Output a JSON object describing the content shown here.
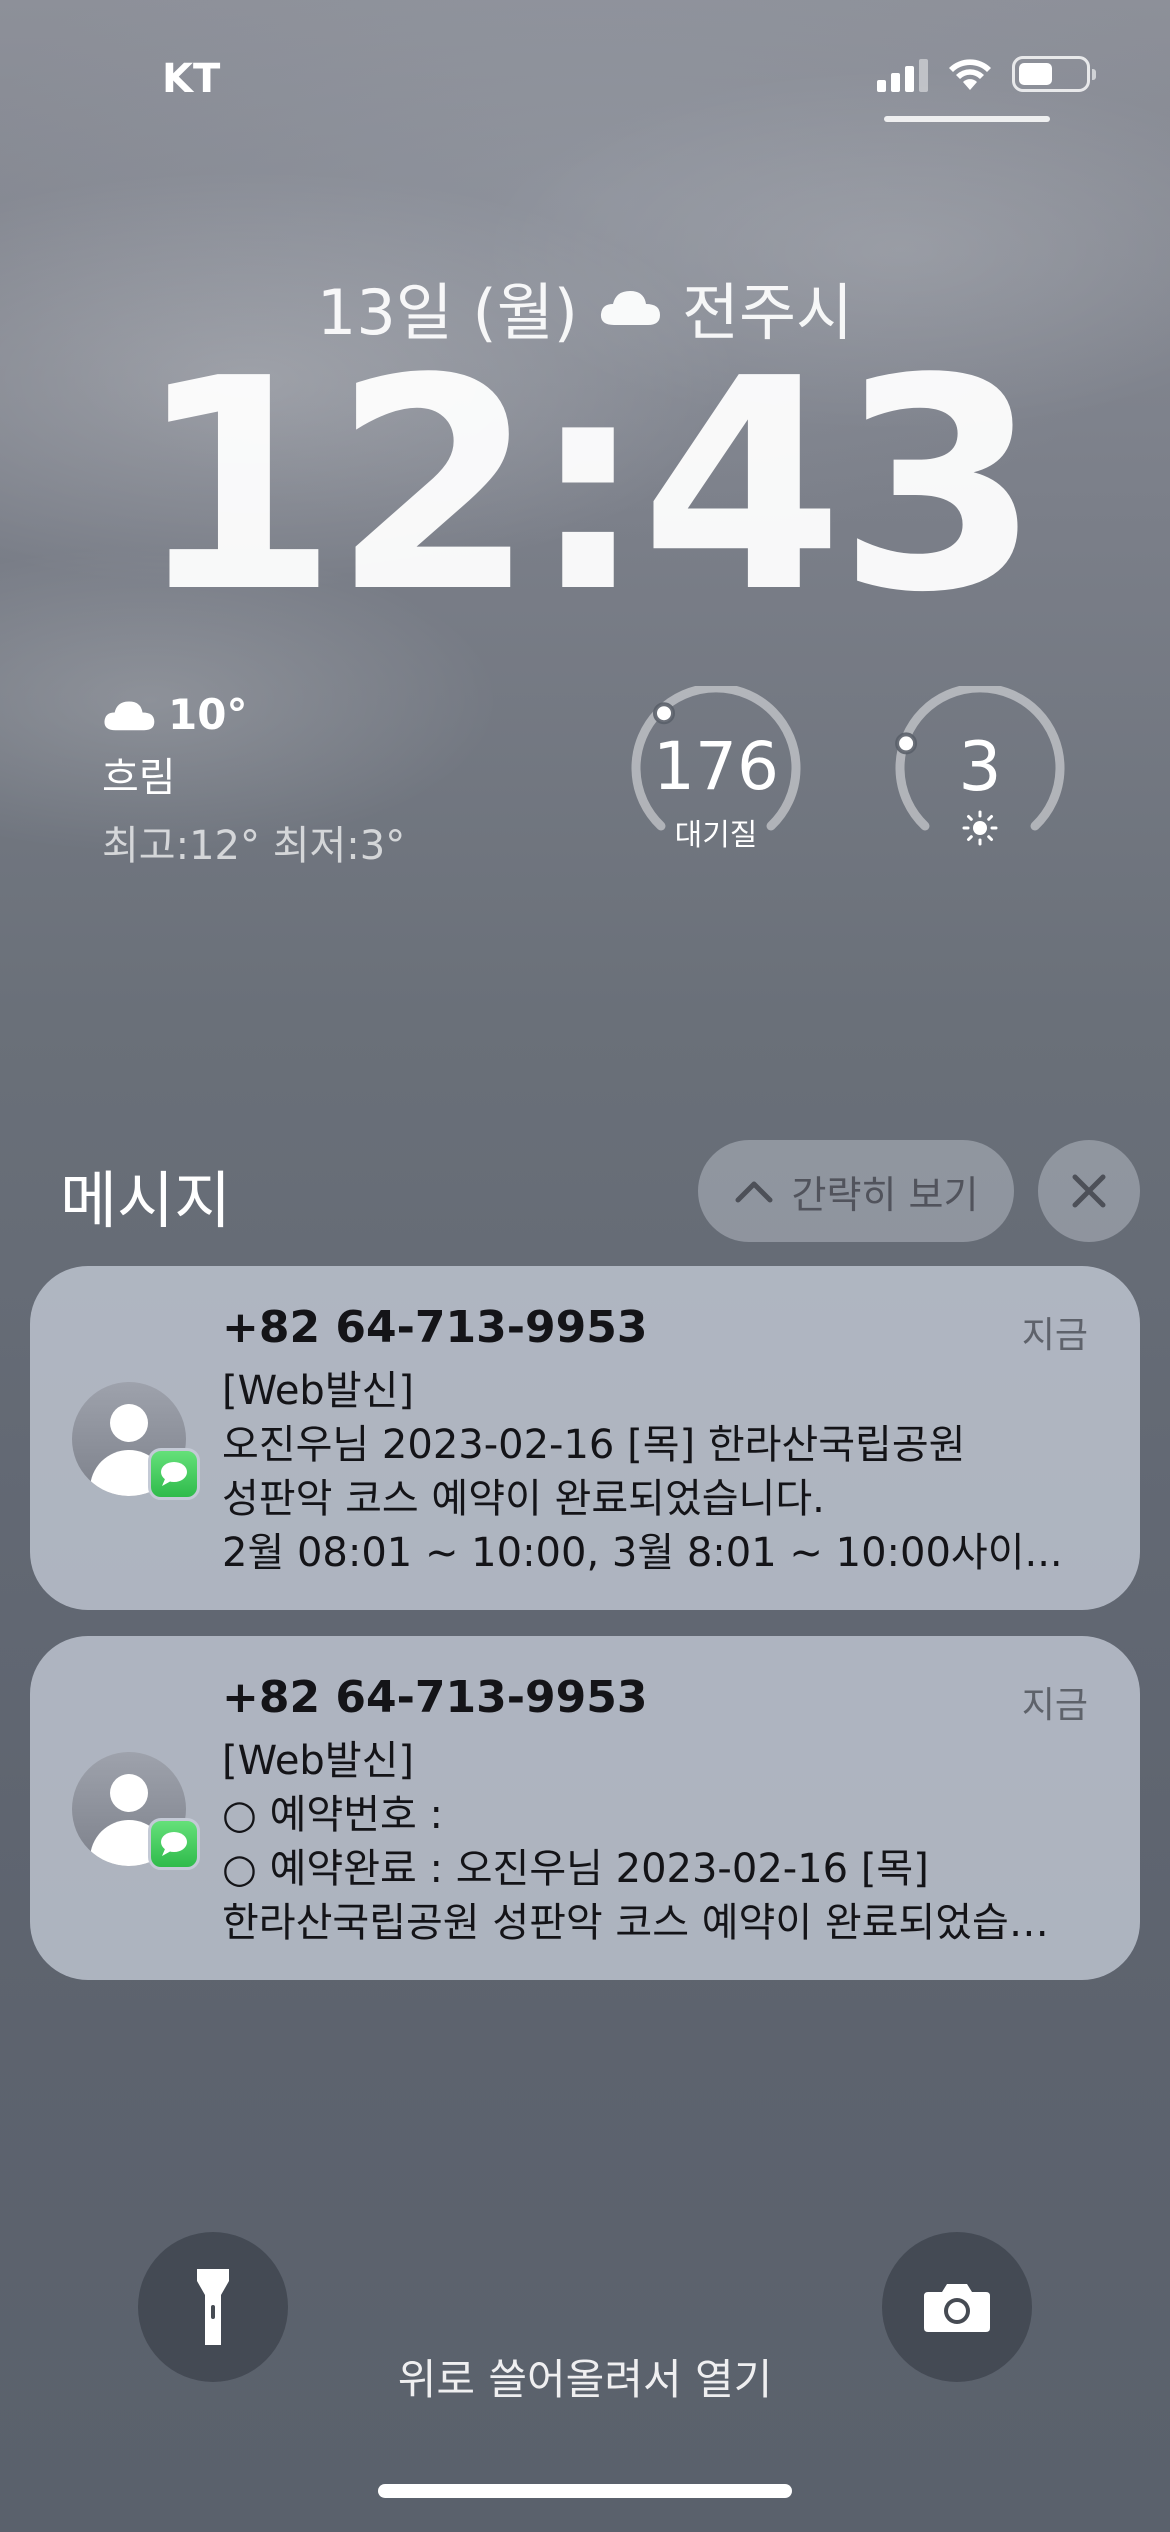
{
  "status_bar": {
    "carrier": "KT",
    "battery_level": 0.5
  },
  "lock_screen": {
    "date_text": "13일 (월)",
    "city": "전주시",
    "time": "12:43"
  },
  "weather_widget": {
    "temp": "10°",
    "condition": "흐림",
    "hi_lo": "최고:12° 최저:3°"
  },
  "aqi_widget": {
    "value": "176",
    "label": "대기질",
    "level": 0.35
  },
  "uv_widget": {
    "value": "3",
    "level": 0.25
  },
  "notification_center": {
    "title": "메시지",
    "collapse_label": "간략히 보기"
  },
  "notifications": [
    {
      "sender": "+82 64-713-9953",
      "time": "지금",
      "lines": [
        "[Web발신]",
        "오진우님  2023-02-16 [목] 한라산국립공원",
        "성판악 코스  예약이 완료되었습니다.",
        " 2월 08:01 ~ 10:00, 3월 8:01 ~ 10:00사이..."
      ]
    },
    {
      "sender": "+82 64-713-9953",
      "time": "지금",
      "lines": [
        "[Web발신]",
        "○ 예약번호 :",
        "○ 예약완료 : 오진우님 2023-02-16 [목]",
        "한라산국립공원 성판악 코스 예약이 완료되었습…"
      ]
    }
  ],
  "bottom": {
    "swipe_hint": "위로 쓸어올려서 열기"
  }
}
